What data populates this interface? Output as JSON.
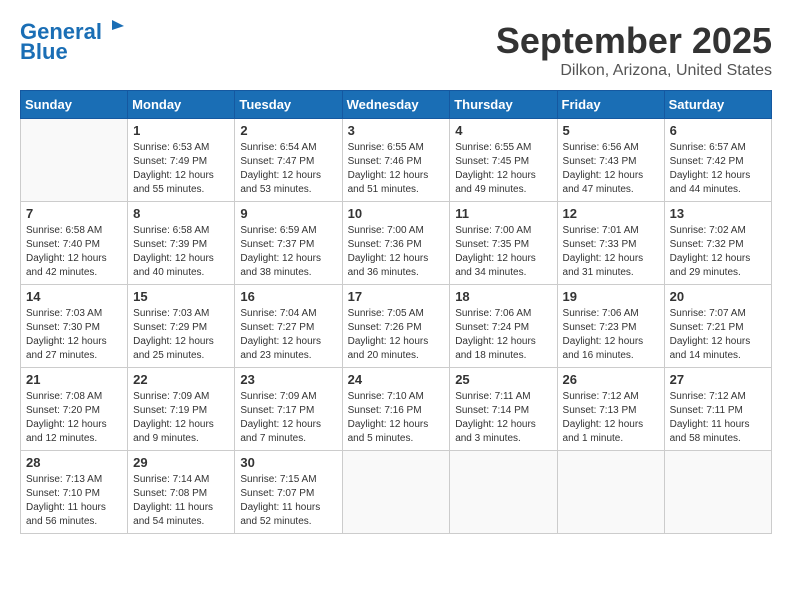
{
  "header": {
    "logo_line1": "General",
    "logo_line2": "Blue",
    "month_title": "September 2025",
    "location": "Dilkon, Arizona, United States"
  },
  "weekdays": [
    "Sunday",
    "Monday",
    "Tuesday",
    "Wednesday",
    "Thursday",
    "Friday",
    "Saturday"
  ],
  "weeks": [
    [
      {
        "day": "",
        "info": ""
      },
      {
        "day": "1",
        "info": "Sunrise: 6:53 AM\nSunset: 7:49 PM\nDaylight: 12 hours\nand 55 minutes."
      },
      {
        "day": "2",
        "info": "Sunrise: 6:54 AM\nSunset: 7:47 PM\nDaylight: 12 hours\nand 53 minutes."
      },
      {
        "day": "3",
        "info": "Sunrise: 6:55 AM\nSunset: 7:46 PM\nDaylight: 12 hours\nand 51 minutes."
      },
      {
        "day": "4",
        "info": "Sunrise: 6:55 AM\nSunset: 7:45 PM\nDaylight: 12 hours\nand 49 minutes."
      },
      {
        "day": "5",
        "info": "Sunrise: 6:56 AM\nSunset: 7:43 PM\nDaylight: 12 hours\nand 47 minutes."
      },
      {
        "day": "6",
        "info": "Sunrise: 6:57 AM\nSunset: 7:42 PM\nDaylight: 12 hours\nand 44 minutes."
      }
    ],
    [
      {
        "day": "7",
        "info": "Sunrise: 6:58 AM\nSunset: 7:40 PM\nDaylight: 12 hours\nand 42 minutes."
      },
      {
        "day": "8",
        "info": "Sunrise: 6:58 AM\nSunset: 7:39 PM\nDaylight: 12 hours\nand 40 minutes."
      },
      {
        "day": "9",
        "info": "Sunrise: 6:59 AM\nSunset: 7:37 PM\nDaylight: 12 hours\nand 38 minutes."
      },
      {
        "day": "10",
        "info": "Sunrise: 7:00 AM\nSunset: 7:36 PM\nDaylight: 12 hours\nand 36 minutes."
      },
      {
        "day": "11",
        "info": "Sunrise: 7:00 AM\nSunset: 7:35 PM\nDaylight: 12 hours\nand 34 minutes."
      },
      {
        "day": "12",
        "info": "Sunrise: 7:01 AM\nSunset: 7:33 PM\nDaylight: 12 hours\nand 31 minutes."
      },
      {
        "day": "13",
        "info": "Sunrise: 7:02 AM\nSunset: 7:32 PM\nDaylight: 12 hours\nand 29 minutes."
      }
    ],
    [
      {
        "day": "14",
        "info": "Sunrise: 7:03 AM\nSunset: 7:30 PM\nDaylight: 12 hours\nand 27 minutes."
      },
      {
        "day": "15",
        "info": "Sunrise: 7:03 AM\nSunset: 7:29 PM\nDaylight: 12 hours\nand 25 minutes."
      },
      {
        "day": "16",
        "info": "Sunrise: 7:04 AM\nSunset: 7:27 PM\nDaylight: 12 hours\nand 23 minutes."
      },
      {
        "day": "17",
        "info": "Sunrise: 7:05 AM\nSunset: 7:26 PM\nDaylight: 12 hours\nand 20 minutes."
      },
      {
        "day": "18",
        "info": "Sunrise: 7:06 AM\nSunset: 7:24 PM\nDaylight: 12 hours\nand 18 minutes."
      },
      {
        "day": "19",
        "info": "Sunrise: 7:06 AM\nSunset: 7:23 PM\nDaylight: 12 hours\nand 16 minutes."
      },
      {
        "day": "20",
        "info": "Sunrise: 7:07 AM\nSunset: 7:21 PM\nDaylight: 12 hours\nand 14 minutes."
      }
    ],
    [
      {
        "day": "21",
        "info": "Sunrise: 7:08 AM\nSunset: 7:20 PM\nDaylight: 12 hours\nand 12 minutes."
      },
      {
        "day": "22",
        "info": "Sunrise: 7:09 AM\nSunset: 7:19 PM\nDaylight: 12 hours\nand 9 minutes."
      },
      {
        "day": "23",
        "info": "Sunrise: 7:09 AM\nSunset: 7:17 PM\nDaylight: 12 hours\nand 7 minutes."
      },
      {
        "day": "24",
        "info": "Sunrise: 7:10 AM\nSunset: 7:16 PM\nDaylight: 12 hours\nand 5 minutes."
      },
      {
        "day": "25",
        "info": "Sunrise: 7:11 AM\nSunset: 7:14 PM\nDaylight: 12 hours\nand 3 minutes."
      },
      {
        "day": "26",
        "info": "Sunrise: 7:12 AM\nSunset: 7:13 PM\nDaylight: 12 hours\nand 1 minute."
      },
      {
        "day": "27",
        "info": "Sunrise: 7:12 AM\nSunset: 7:11 PM\nDaylight: 11 hours\nand 58 minutes."
      }
    ],
    [
      {
        "day": "28",
        "info": "Sunrise: 7:13 AM\nSunset: 7:10 PM\nDaylight: 11 hours\nand 56 minutes."
      },
      {
        "day": "29",
        "info": "Sunrise: 7:14 AM\nSunset: 7:08 PM\nDaylight: 11 hours\nand 54 minutes."
      },
      {
        "day": "30",
        "info": "Sunrise: 7:15 AM\nSunset: 7:07 PM\nDaylight: 11 hours\nand 52 minutes."
      },
      {
        "day": "",
        "info": ""
      },
      {
        "day": "",
        "info": ""
      },
      {
        "day": "",
        "info": ""
      },
      {
        "day": "",
        "info": ""
      }
    ]
  ]
}
